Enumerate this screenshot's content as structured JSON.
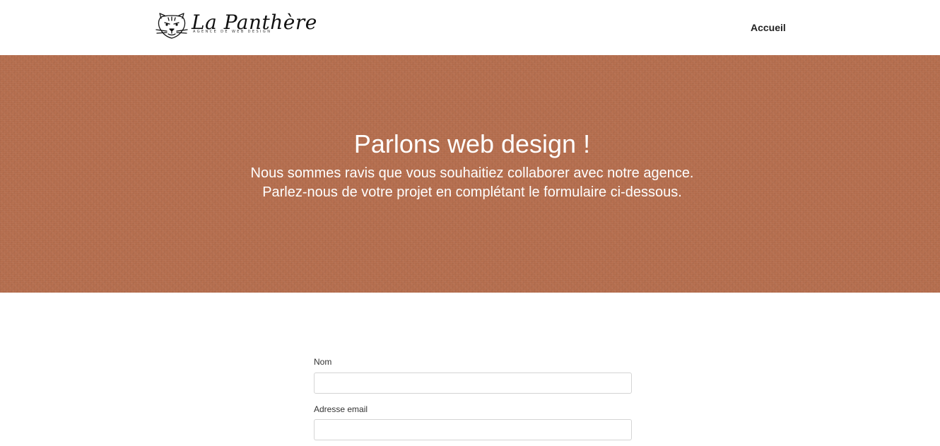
{
  "header": {
    "logo": {
      "name": "La Panthère",
      "tagline": "AGENCE DE WEB DESIGN",
      "icon": "panther-head-icon"
    },
    "nav": [
      {
        "label": "Accueil"
      }
    ]
  },
  "hero": {
    "title": "Parlons web design !",
    "line1": "Nous sommes ravis que vous souhaitiez collaborer avec notre agence.",
    "line2": "Parlez-nous de votre projet en complétant le formulaire ci-dessous.",
    "background_color": "#b56e4e"
  },
  "form": {
    "fields": [
      {
        "label": "Nom",
        "value": "",
        "placeholder": ""
      },
      {
        "label": "Adresse email",
        "value": "",
        "placeholder": ""
      }
    ]
  }
}
